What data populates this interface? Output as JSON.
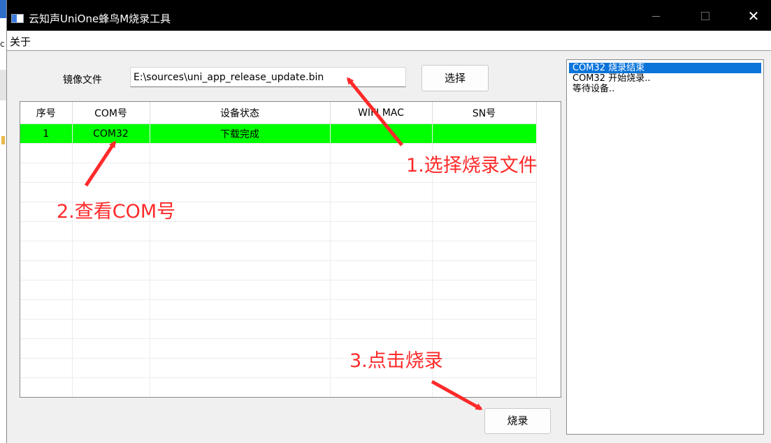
{
  "window": {
    "title": "云知声UniOne蜂鸟M烧录工具",
    "controls": {
      "minimize": "—",
      "maximize": "□",
      "close": "✕"
    }
  },
  "menu": {
    "about": "关于"
  },
  "image_label": "镜像文件",
  "file_path": "E:\\sources\\uni_app_release_update.bin",
  "buttons": {
    "select": "选择",
    "burn": "烧录"
  },
  "table": {
    "headers": [
      "序号",
      "COM号",
      "设备状态",
      "WIFI MAC",
      "SN号"
    ],
    "rows": [
      {
        "index": "1",
        "com": "COM32",
        "status": "下载完成",
        "mac": "",
        "sn": ""
      }
    ],
    "row_highlight_color": "#00ff00"
  },
  "log": {
    "items": [
      "COM32 烧录结束",
      "COM32 开始烧录..",
      "等待设备.."
    ],
    "selected_color": "#0a74da"
  },
  "annotations": {
    "step1": "1.选择烧录文件",
    "step2": "2.查看COM号",
    "step3": "3.点击烧录",
    "color": "#ff2a2a"
  },
  "icons": {
    "app": "app-window-icon",
    "arrows": [
      "red-arrow-icon",
      "red-arrow-icon",
      "red-arrow-icon"
    ]
  }
}
